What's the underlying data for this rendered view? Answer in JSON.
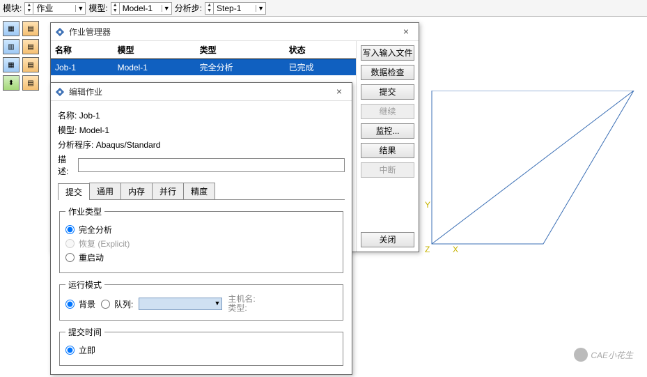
{
  "topbar": {
    "module_label": "模块:",
    "module_value": "作业",
    "model_label": "模型:",
    "model_value": "Model-1",
    "step_label": "分析步:",
    "step_value": "Step-1"
  },
  "jobmgr": {
    "title": "作业管理器",
    "cols": {
      "name": "名称",
      "model": "模型",
      "type": "类型",
      "status": "状态"
    },
    "row": {
      "name": "Job-1",
      "model": "Model-1",
      "type": "完全分析",
      "status": "已完成"
    },
    "buttons": {
      "write": "写入输入文件",
      "check": "数据检查",
      "submit": "提交",
      "continue": "继续",
      "monitor": "监控...",
      "results": "结果",
      "abort": "中断"
    },
    "close": "关闭"
  },
  "editjob": {
    "title": "编辑作业",
    "name_label": "名称:",
    "name_value": "Job-1",
    "model_label": "模型:",
    "model_value": "Model-1",
    "proc_label": "分析程序:",
    "proc_value": "Abaqus/Standard",
    "desc_label": "描述:",
    "desc_value": "",
    "tabs": {
      "submit": "提交",
      "general": "通用",
      "memory": "内存",
      "parallel": "并行",
      "precision": "精度"
    },
    "jobtype": {
      "legend": "作业类型",
      "full": "完全分析",
      "recover": "恢复 (Explicit)",
      "restart": "重启动"
    },
    "runmode": {
      "legend": "运行模式",
      "background": "背景",
      "queue": "队列:",
      "host": "主机名:",
      "type": "类型:"
    },
    "submit_time": {
      "legend": "提交时间",
      "immediate": "立即"
    }
  },
  "watermark": "CAE小花生"
}
